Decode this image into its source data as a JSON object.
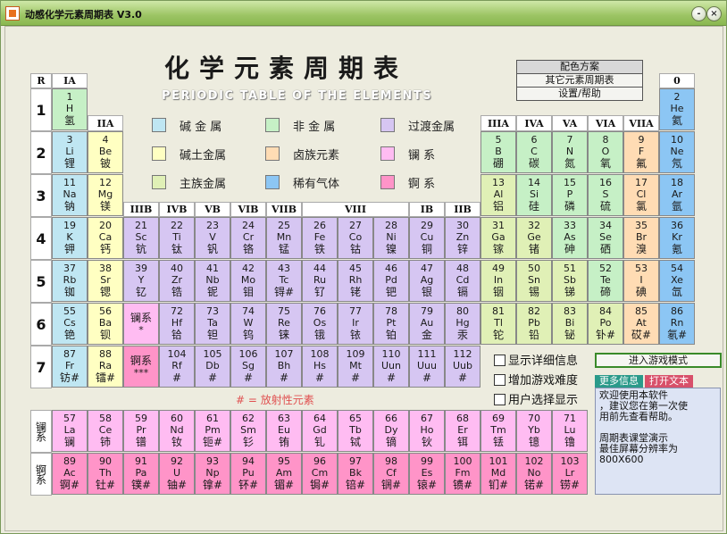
{
  "window": {
    "title": "动感化学元素周期表 V3.0",
    "min": "-",
    "close": "×"
  },
  "main_title": "化学元素周期表",
  "sub_title": "PERIODIC TABLE OF THE ELEMENTS",
  "menu": [
    "配色方案",
    "其它元素周期表",
    "设置/帮助"
  ],
  "colors": {
    "alkali": "#bfe6f2",
    "alkaline": "#ffffc2",
    "main": "#e0f0b6",
    "nonmetal": "#c6f0c6",
    "transition": "#d6c6f2",
    "halogen": "#ffdcb4",
    "noble": "#8cc6f4",
    "lanth": "#ffbcf2",
    "actin": "#ff94c8"
  },
  "legend": [
    {
      "label": "碱 金 属",
      "color": "#bfe6f2"
    },
    {
      "label": "非 金 属",
      "color": "#c6f0c6"
    },
    {
      "label": "过渡金属",
      "color": "#d6c6f2"
    },
    {
      "label": "碱土金属",
      "color": "#ffffc2"
    },
    {
      "label": "卤族元素",
      "color": "#ffdcb4"
    },
    {
      "label": "镧      系",
      "color": "#ffbcf2"
    },
    {
      "label": "主族金属",
      "color": "#e0f0b6"
    },
    {
      "label": "稀有气体",
      "color": "#8cc6f4"
    },
    {
      "label": "锕      系",
      "color": "#ff94c8"
    }
  ],
  "row_header": "R",
  "groups": {
    "g1": "IA",
    "g2": "IIA",
    "g3": "IIIB",
    "g4": "IVB",
    "g5": "VB",
    "g6": "VIB",
    "g7": "VIIB",
    "g8": "VIII",
    "g11": "IB",
    "g12": "IIB",
    "g13": "IIIA",
    "g14": "IVA",
    "g15": "VA",
    "g16": "VIA",
    "g17": "VIIA",
    "g18": "0"
  },
  "periods": [
    "1",
    "2",
    "3",
    "4",
    "5",
    "6",
    "7"
  ],
  "elements": [
    {
      "n": "1",
      "s": "H",
      "z": "氢",
      "c": "nonmetal",
      "g": 1,
      "p": 1
    },
    {
      "n": "2",
      "s": "He",
      "z": "氦",
      "c": "noble",
      "g": 18,
      "p": 1
    },
    {
      "n": "3",
      "s": "Li",
      "z": "锂",
      "c": "alkali",
      "g": 1,
      "p": 2
    },
    {
      "n": "4",
      "s": "Be",
      "z": "铍",
      "c": "alkaline",
      "g": 2,
      "p": 2
    },
    {
      "n": "5",
      "s": "B",
      "z": "硼",
      "c": "nonmetal",
      "g": 13,
      "p": 2
    },
    {
      "n": "6",
      "s": "C",
      "z": "碳",
      "c": "nonmetal",
      "g": 14,
      "p": 2
    },
    {
      "n": "7",
      "s": "N",
      "z": "氮",
      "c": "nonmetal",
      "g": 15,
      "p": 2
    },
    {
      "n": "8",
      "s": "O",
      "z": "氧",
      "c": "nonmetal",
      "g": 16,
      "p": 2
    },
    {
      "n": "9",
      "s": "F",
      "z": "氟",
      "c": "halogen",
      "g": 17,
      "p": 2
    },
    {
      "n": "10",
      "s": "Ne",
      "z": "氖",
      "c": "noble",
      "g": 18,
      "p": 2
    },
    {
      "n": "11",
      "s": "Na",
      "z": "钠",
      "c": "alkali",
      "g": 1,
      "p": 3
    },
    {
      "n": "12",
      "s": "Mg",
      "z": "镁",
      "c": "alkaline",
      "g": 2,
      "p": 3
    },
    {
      "n": "13",
      "s": "Al",
      "z": "铝",
      "c": "main",
      "g": 13,
      "p": 3
    },
    {
      "n": "14",
      "s": "Si",
      "z": "硅",
      "c": "nonmetal",
      "g": 14,
      "p": 3
    },
    {
      "n": "15",
      "s": "P",
      "z": "磷",
      "c": "nonmetal",
      "g": 15,
      "p": 3
    },
    {
      "n": "16",
      "s": "S",
      "z": "硫",
      "c": "nonmetal",
      "g": 16,
      "p": 3
    },
    {
      "n": "17",
      "s": "Cl",
      "z": "氯",
      "c": "halogen",
      "g": 17,
      "p": 3
    },
    {
      "n": "18",
      "s": "Ar",
      "z": "氩",
      "c": "noble",
      "g": 18,
      "p": 3
    },
    {
      "n": "19",
      "s": "K",
      "z": "钾",
      "c": "alkali",
      "g": 1,
      "p": 4
    },
    {
      "n": "20",
      "s": "Ca",
      "z": "钙",
      "c": "alkaline",
      "g": 2,
      "p": 4
    },
    {
      "n": "21",
      "s": "Sc",
      "z": "钪",
      "c": "transition",
      "g": 3,
      "p": 4
    },
    {
      "n": "22",
      "s": "Ti",
      "z": "钛",
      "c": "transition",
      "g": 4,
      "p": 4
    },
    {
      "n": "23",
      "s": "V",
      "z": "钒",
      "c": "transition",
      "g": 5,
      "p": 4
    },
    {
      "n": "24",
      "s": "Cr",
      "z": "铬",
      "c": "transition",
      "g": 6,
      "p": 4
    },
    {
      "n": "25",
      "s": "Mn",
      "z": "锰",
      "c": "transition",
      "g": 7,
      "p": 4
    },
    {
      "n": "26",
      "s": "Fe",
      "z": "铁",
      "c": "transition",
      "g": 8,
      "p": 4
    },
    {
      "n": "27",
      "s": "Co",
      "z": "钴",
      "c": "transition",
      "g": 9,
      "p": 4
    },
    {
      "n": "28",
      "s": "Ni",
      "z": "镍",
      "c": "transition",
      "g": 10,
      "p": 4
    },
    {
      "n": "29",
      "s": "Cu",
      "z": "铜",
      "c": "transition",
      "g": 11,
      "p": 4
    },
    {
      "n": "30",
      "s": "Zn",
      "z": "锌",
      "c": "transition",
      "g": 12,
      "p": 4
    },
    {
      "n": "31",
      "s": "Ga",
      "z": "镓",
      "c": "main",
      "g": 13,
      "p": 4
    },
    {
      "n": "32",
      "s": "Ge",
      "z": "锗",
      "c": "main",
      "g": 14,
      "p": 4
    },
    {
      "n": "33",
      "s": "As",
      "z": "砷",
      "c": "nonmetal",
      "g": 15,
      "p": 4
    },
    {
      "n": "34",
      "s": "Se",
      "z": "硒",
      "c": "nonmetal",
      "g": 16,
      "p": 4
    },
    {
      "n": "35",
      "s": "Br",
      "z": "溴",
      "c": "halogen",
      "g": 17,
      "p": 4
    },
    {
      "n": "36",
      "s": "Kr",
      "z": "氪",
      "c": "noble",
      "g": 18,
      "p": 4
    },
    {
      "n": "37",
      "s": "Rb",
      "z": "铷",
      "c": "alkali",
      "g": 1,
      "p": 5
    },
    {
      "n": "38",
      "s": "Sr",
      "z": "锶",
      "c": "alkaline",
      "g": 2,
      "p": 5
    },
    {
      "n": "39",
      "s": "Y",
      "z": "钇",
      "c": "transition",
      "g": 3,
      "p": 5
    },
    {
      "n": "40",
      "s": "Zr",
      "z": "锆",
      "c": "transition",
      "g": 4,
      "p": 5
    },
    {
      "n": "41",
      "s": "Nb",
      "z": "铌",
      "c": "transition",
      "g": 5,
      "p": 5
    },
    {
      "n": "42",
      "s": "Mo",
      "z": "钼",
      "c": "transition",
      "g": 6,
      "p": 5
    },
    {
      "n": "43",
      "s": "Tc",
      "z": "锝#",
      "c": "transition",
      "g": 7,
      "p": 5
    },
    {
      "n": "44",
      "s": "Ru",
      "z": "钌",
      "c": "transition",
      "g": 8,
      "p": 5
    },
    {
      "n": "45",
      "s": "Rh",
      "z": "铑",
      "c": "transition",
      "g": 9,
      "p": 5
    },
    {
      "n": "46",
      "s": "Pd",
      "z": "钯",
      "c": "transition",
      "g": 10,
      "p": 5
    },
    {
      "n": "47",
      "s": "Ag",
      "z": "银",
      "c": "transition",
      "g": 11,
      "p": 5
    },
    {
      "n": "48",
      "s": "Cd",
      "z": "镉",
      "c": "transition",
      "g": 12,
      "p": 5
    },
    {
      "n": "49",
      "s": "In",
      "z": "铟",
      "c": "main",
      "g": 13,
      "p": 5
    },
    {
      "n": "50",
      "s": "Sn",
      "z": "锡",
      "c": "main",
      "g": 14,
      "p": 5
    },
    {
      "n": "51",
      "s": "Sb",
      "z": "锑",
      "c": "main",
      "g": 15,
      "p": 5
    },
    {
      "n": "52",
      "s": "Te",
      "z": "碲",
      "c": "nonmetal",
      "g": 16,
      "p": 5
    },
    {
      "n": "53",
      "s": "I",
      "z": "碘",
      "c": "halogen",
      "g": 17,
      "p": 5
    },
    {
      "n": "54",
      "s": "Xe",
      "z": "氙",
      "c": "noble",
      "g": 18,
      "p": 5
    },
    {
      "n": "55",
      "s": "Cs",
      "z": "铯",
      "c": "alkali",
      "g": 1,
      "p": 6
    },
    {
      "n": "56",
      "s": "Ba",
      "z": "钡",
      "c": "alkaline",
      "g": 2,
      "p": 6
    },
    {
      "n": "",
      "s": "*",
      "z": "镧系",
      "c": "lanth",
      "g": 3,
      "p": 6
    },
    {
      "n": "72",
      "s": "Hf",
      "z": "铪",
      "c": "transition",
      "g": 4,
      "p": 6
    },
    {
      "n": "73",
      "s": "Ta",
      "z": "钽",
      "c": "transition",
      "g": 5,
      "p": 6
    },
    {
      "n": "74",
      "s": "W",
      "z": "钨",
      "c": "transition",
      "g": 6,
      "p": 6
    },
    {
      "n": "75",
      "s": "Re",
      "z": "铼",
      "c": "transition",
      "g": 7,
      "p": 6
    },
    {
      "n": "76",
      "s": "Os",
      "z": "锇",
      "c": "transition",
      "g": 8,
      "p": 6
    },
    {
      "n": "77",
      "s": "Ir",
      "z": "铱",
      "c": "transition",
      "g": 9,
      "p": 6
    },
    {
      "n": "78",
      "s": "Pt",
      "z": "铂",
      "c": "transition",
      "g": 10,
      "p": 6
    },
    {
      "n": "79",
      "s": "Au",
      "z": "金",
      "c": "transition",
      "g": 11,
      "p": 6
    },
    {
      "n": "80",
      "s": "Hg",
      "z": "汞",
      "c": "transition",
      "g": 12,
      "p": 6
    },
    {
      "n": "81",
      "s": "Tl",
      "z": "铊",
      "c": "main",
      "g": 13,
      "p": 6
    },
    {
      "n": "82",
      "s": "Pb",
      "z": "铅",
      "c": "main",
      "g": 14,
      "p": 6
    },
    {
      "n": "83",
      "s": "Bi",
      "z": "铋",
      "c": "main",
      "g": 15,
      "p": 6
    },
    {
      "n": "84",
      "s": "Po",
      "z": "钋#",
      "c": "main",
      "g": 16,
      "p": 6
    },
    {
      "n": "85",
      "s": "At",
      "z": "砹#",
      "c": "halogen",
      "g": 17,
      "p": 6
    },
    {
      "n": "86",
      "s": "Rn",
      "z": "氡#",
      "c": "noble",
      "g": 18,
      "p": 6
    },
    {
      "n": "87",
      "s": "Fr",
      "z": "钫#",
      "c": "alkali",
      "g": 1,
      "p": 7
    },
    {
      "n": "88",
      "s": "Ra",
      "z": "镭#",
      "c": "alkaline",
      "g": 2,
      "p": 7
    },
    {
      "n": "",
      "s": "***",
      "z": "锕系",
      "c": "actin",
      "g": 3,
      "p": 7
    },
    {
      "n": "104",
      "s": "Rf",
      "z": "#",
      "c": "transition",
      "g": 4,
      "p": 7
    },
    {
      "n": "105",
      "s": "Db",
      "z": "#",
      "c": "transition",
      "g": 5,
      "p": 7
    },
    {
      "n": "106",
      "s": "Sg",
      "z": "#",
      "c": "transition",
      "g": 6,
      "p": 7
    },
    {
      "n": "107",
      "s": "Bh",
      "z": "#",
      "c": "transition",
      "g": 7,
      "p": 7
    },
    {
      "n": "108",
      "s": "Hs",
      "z": "#",
      "c": "transition",
      "g": 8,
      "p": 7
    },
    {
      "n": "109",
      "s": "Mt",
      "z": "#",
      "c": "transition",
      "g": 9,
      "p": 7
    },
    {
      "n": "110",
      "s": "Uun",
      "z": "#",
      "c": "transition",
      "g": 10,
      "p": 7
    },
    {
      "n": "111",
      "s": "Uuu",
      "z": "#",
      "c": "transition",
      "g": 11,
      "p": 7
    },
    {
      "n": "112",
      "s": "Uub",
      "z": "#",
      "c": "transition",
      "g": 12,
      "p": 7
    }
  ],
  "lanthanides_label": "镧系",
  "actinides_label": "锕系",
  "lanthanides": [
    {
      "n": "57",
      "s": "La",
      "z": "镧"
    },
    {
      "n": "58",
      "s": "Ce",
      "z": "铈"
    },
    {
      "n": "59",
      "s": "Pr",
      "z": "镨"
    },
    {
      "n": "60",
      "s": "Nd",
      "z": "钕"
    },
    {
      "n": "61",
      "s": "Pm",
      "z": "钷#"
    },
    {
      "n": "62",
      "s": "Sm",
      "z": "钐"
    },
    {
      "n": "63",
      "s": "Eu",
      "z": "铕"
    },
    {
      "n": "64",
      "s": "Gd",
      "z": "钆"
    },
    {
      "n": "65",
      "s": "Tb",
      "z": "铽"
    },
    {
      "n": "66",
      "s": "Dy",
      "z": "镝"
    },
    {
      "n": "67",
      "s": "Ho",
      "z": "钬"
    },
    {
      "n": "68",
      "s": "Er",
      "z": "铒"
    },
    {
      "n": "69",
      "s": "Tm",
      "z": "铥"
    },
    {
      "n": "70",
      "s": "Yb",
      "z": "镱"
    },
    {
      "n": "71",
      "s": "Lu",
      "z": "镥"
    }
  ],
  "actinides": [
    {
      "n": "89",
      "s": "Ac",
      "z": "锕#"
    },
    {
      "n": "90",
      "s": "Th",
      "z": "钍#"
    },
    {
      "n": "91",
      "s": "Pa",
      "z": "镤#"
    },
    {
      "n": "92",
      "s": "U",
      "z": "铀#"
    },
    {
      "n": "93",
      "s": "Np",
      "z": "镎#"
    },
    {
      "n": "94",
      "s": "Pu",
      "z": "钚#"
    },
    {
      "n": "95",
      "s": "Am",
      "z": "镅#"
    },
    {
      "n": "96",
      "s": "Cm",
      "z": "锔#"
    },
    {
      "n": "97",
      "s": "Bk",
      "z": "锫#"
    },
    {
      "n": "98",
      "s": "Cf",
      "z": "锎#"
    },
    {
      "n": "99",
      "s": "Es",
      "z": "锿#"
    },
    {
      "n": "100",
      "s": "Fm",
      "z": "镄#"
    },
    {
      "n": "101",
      "s": "Md",
      "z": "钔#"
    },
    {
      "n": "102",
      "s": "No",
      "z": "锘#"
    },
    {
      "n": "103",
      "s": "Lr",
      "z": "铹#"
    }
  ],
  "radioactive_note": "# = 放射性元素",
  "checkboxes": [
    "显示详细信息",
    "增加游戏难度",
    "用户选择显示"
  ],
  "game_button": "进入游戏模式",
  "more_info": "更多信息",
  "open_text": "打开文本",
  "info_lines": [
    "欢迎使用本软件",
    "，建议您在第一次使",
    "用前先查看帮助。",
    "",
    "     周期表课堂演示",
    "最佳屏幕分辨率为",
    "800X600"
  ]
}
